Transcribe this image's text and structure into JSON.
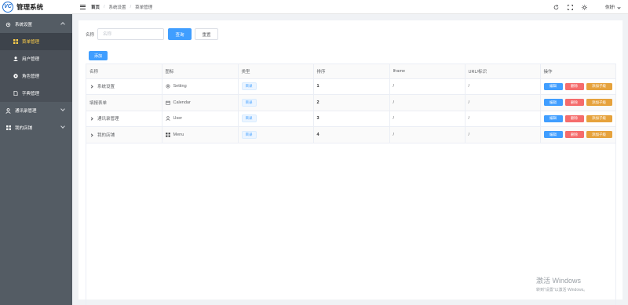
{
  "logo": {
    "mark": "VC",
    "title": "管理系统"
  },
  "sidebar": {
    "items": [
      {
        "label": "系统设置",
        "icon": "gear-icon",
        "expanded": true
      },
      {
        "label": "菜单管理",
        "icon": "grid-icon",
        "active": true
      },
      {
        "label": "用户管理",
        "icon": "user-icon"
      },
      {
        "label": "角色管理",
        "icon": "role-icon"
      },
      {
        "label": "字典管理",
        "icon": "document-icon"
      },
      {
        "label": "通讯录管理",
        "icon": "contact-icon"
      },
      {
        "label": "我的店铺",
        "icon": "grid-icon"
      }
    ]
  },
  "header": {
    "breadcrumb": [
      "首页",
      "系统设置",
      "菜单管理"
    ],
    "user": "你好!"
  },
  "search": {
    "label": "名称",
    "placeholder": "名称",
    "value": "",
    "query_label": "查询",
    "reset_label": "重置"
  },
  "toolbar": {
    "add_label": "添加"
  },
  "table": {
    "columns": [
      "名称",
      "图标",
      "类型",
      "排序",
      "Iframe",
      "URL/标识",
      "操作"
    ],
    "rows": [
      {
        "name": "系统设置",
        "expandable": true,
        "icon_name": "Setting",
        "icon": "gear-icon",
        "type": "目录",
        "sort": "1",
        "iframe": "/",
        "url": "/"
      },
      {
        "name": "填报表单",
        "expandable": false,
        "icon_name": "Calendar",
        "icon": "calendar-icon",
        "type": "目录",
        "sort": "2",
        "iframe": "/",
        "url": "/"
      },
      {
        "name": "通讯录管理",
        "expandable": true,
        "icon_name": "User",
        "icon": "user-icon",
        "type": "目录",
        "sort": "3",
        "iframe": "/",
        "url": "/"
      },
      {
        "name": "我的店铺",
        "expandable": true,
        "icon_name": "Menu",
        "icon": "menu-grid-icon",
        "type": "目录",
        "sort": "4",
        "iframe": "/",
        "url": "/"
      }
    ],
    "actions": {
      "edit": "编辑",
      "delete": "删除",
      "add_child": "添加子级"
    }
  },
  "watermark": {
    "line1": "激活 Windows",
    "line2": "转到\"设置\"以激活 Windows。"
  },
  "colors": {
    "primary": "#409eff",
    "danger": "#f56c6c",
    "warning": "#e6a23c",
    "sidebar_bg": "#545c64",
    "active_text": "#ffd04b"
  }
}
